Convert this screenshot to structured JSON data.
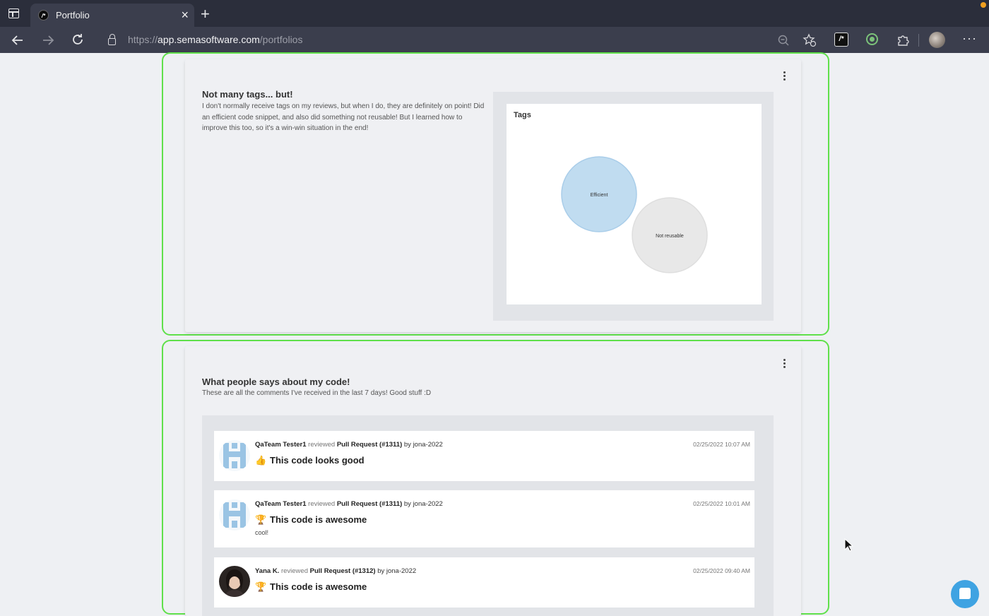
{
  "browser": {
    "tab_title": "Portfolio",
    "tab_close": "×",
    "new_tab": "+",
    "url_scheme": "https://",
    "url_host": "app.semasoftware.com",
    "url_path": "/portfolios",
    "more": "···",
    "ext_label": "/*"
  },
  "tags_card": {
    "title": "Not many tags... but!",
    "description": "I don't normally receive tags on my reviews, but when I do, they are definitely on point! Did an efficient code snippet, and also did something not reusable! But I learned how to improve this too, so it's a win-win situation in the end!",
    "chart_data": {
      "type": "bubble",
      "title": "Tags",
      "bubbles": [
        {
          "label": "Efficient",
          "value": 1,
          "color": "#c0dcf0",
          "stroke": "#a9cde9"
        },
        {
          "label": "Not reusable",
          "value": 1,
          "color": "#e8e8e8",
          "stroke": "#dedede"
        }
      ]
    }
  },
  "comments_card": {
    "title": "What people says about my code!",
    "subtitle": "These are all the comments I've received in the last 7 days! Good stuff :D",
    "comments": [
      {
        "reviewer": "QaTeam Tester1",
        "verb": "reviewed",
        "pr": "Pull Request (#1311)",
        "by": "by jona-2022",
        "date": "02/25/2022 10:07 AM",
        "emoji": "👍",
        "reaction": "This code looks good",
        "note": ""
      },
      {
        "reviewer": "QaTeam Tester1",
        "verb": "reviewed",
        "pr": "Pull Request (#1311)",
        "by": "by jona-2022",
        "date": "02/25/2022 10:01 AM",
        "emoji": "🏆",
        "reaction": "This code is awesome",
        "note": "cool!"
      },
      {
        "reviewer": "Yana K.",
        "verb": "reviewed",
        "pr": "Pull Request (#1312)",
        "by": "by jona-2022",
        "date": "02/25/2022 09:40 AM",
        "emoji": "🏆",
        "reaction": "This code is awesome",
        "note": ""
      }
    ]
  }
}
